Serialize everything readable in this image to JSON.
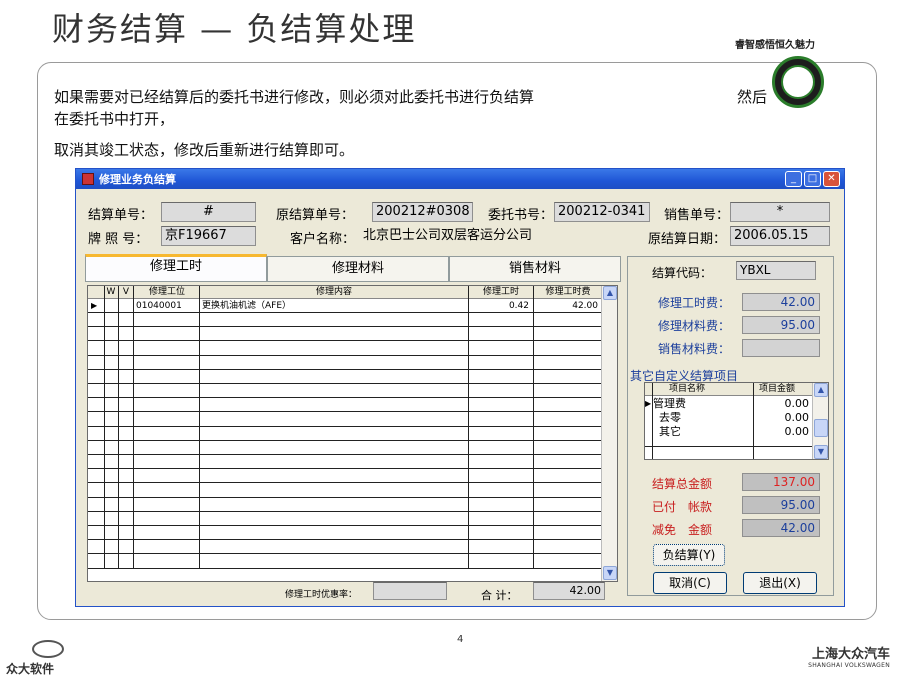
{
  "slide": {
    "title": "财务结算 — 负结算处理",
    "slogan": "睿智感悟恒久魅力",
    "intro_line1": "如果需要对已经结算后的委托书进行修改，则必须对此委托书进行负结算",
    "intro_tail": "然后",
    "intro_line2": "在委托书中打开，",
    "intro_line3": "取消其竣工状态，修改后重新进行结算即可。",
    "page_number": "4",
    "vendor_name": "众大软件",
    "brand_cn": "上海大众汽车",
    "brand_en": "SHANGHAI VOLKSWAGEN"
  },
  "window": {
    "title": "修理业务负结算",
    "buttons": {
      "minimize": "_",
      "maximize": "□",
      "close": "✕"
    }
  },
  "form": {
    "settle_no_label": "结算单号：",
    "settle_no_value": "#",
    "orig_settle_no_label": "原结算单号：",
    "orig_settle_no_value": "200212#0308",
    "order_no_label": "委托书号：",
    "order_no_value": "200212-0341",
    "sales_no_label": "销售单号：",
    "sales_no_value": "*",
    "plate_label": "牌 照 号：",
    "plate_value": "京F19667",
    "customer_label": "客户名称：",
    "customer_value": "北京巴士公司双层客运分公司",
    "orig_date_label": "原结算日期：",
    "orig_date_value": "2006.05.15"
  },
  "tabs": [
    {
      "label": "修理工时",
      "active": true
    },
    {
      "label": "修理材料",
      "active": false
    },
    {
      "label": "销售材料",
      "active": false
    }
  ],
  "grid": {
    "headers": [
      "W",
      "V",
      "修理工位",
      "修理内容",
      "修理工时",
      "修理工时费"
    ],
    "rows": [
      {
        "marker": "▶",
        "w": "",
        "v": "",
        "code": "01040001",
        "content": "更换机油机滤（AFE）",
        "hours": "0.42",
        "fee": "42.00"
      }
    ],
    "discount_label": "修理工时优惠率：",
    "discount_value": "",
    "total_label": "合 计：",
    "total_value": "42.00"
  },
  "panel": {
    "code_label": "结算代码：",
    "code_value": "YBXL",
    "labor_fee_label": "修理工时费：",
    "labor_fee_value": "42.00",
    "material_fee_label": "修理材料费：",
    "material_fee_value": "95.00",
    "sales_fee_label": "销售材料费：",
    "sales_fee_value": "",
    "custom_items_title": "其它自定义结算项目",
    "custom_headers": [
      "项目名称",
      "项目金额"
    ],
    "custom_items": [
      {
        "marker": "▶",
        "name": "管理费",
        "amount": "0.00"
      },
      {
        "marker": "",
        "name": "去零",
        "amount": "0.00"
      },
      {
        "marker": "",
        "name": "其它",
        "amount": "0.00"
      }
    ],
    "total_label": "结算总金额",
    "total_value": "137.00",
    "paid_label": "已付　帐款",
    "paid_value": "95.00",
    "discount_label": "减免　金额",
    "discount_value": "42.00",
    "neg_settle_button": "负结算(Y)",
    "cancel_button": "取消(C)",
    "exit_button": "退出(X)"
  },
  "colors": {
    "titlebar": "#1f56d6",
    "active_tab_accent": "#f7b830",
    "value_blue": "#1c3f9c",
    "value_red": "#d22222"
  }
}
